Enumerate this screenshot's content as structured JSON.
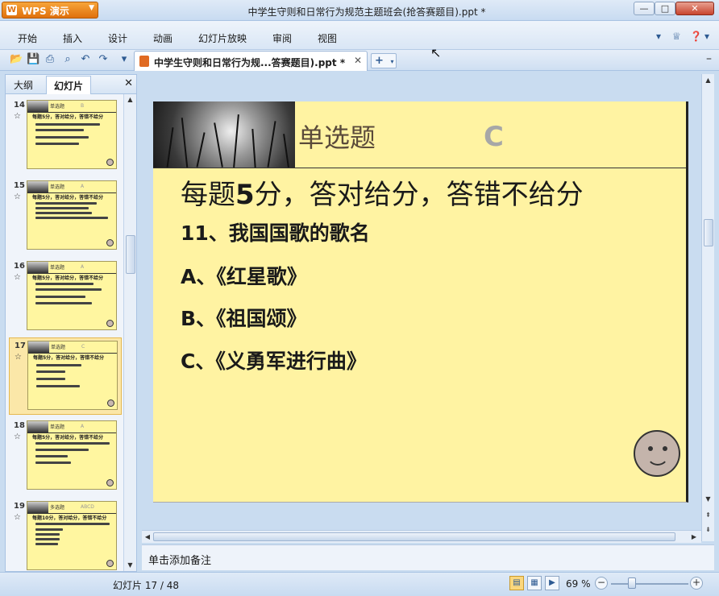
{
  "app": {
    "name": "WPS 演示",
    "window_title": "中学生守则和日常行为规范主题班会(抢答赛题目).ppt *"
  },
  "window_controls": {
    "minimize": "—",
    "maximize": "□",
    "close": "✕"
  },
  "menu": {
    "items": [
      "开始",
      "插入",
      "设计",
      "动画",
      "幻灯片放映",
      "审阅",
      "视图"
    ]
  },
  "document_tab": {
    "label": "中学生守则和日常行为规...答赛题目).ppt *",
    "close": "✕",
    "new_tab": "+"
  },
  "panel": {
    "tabs": [
      "大纲",
      "幻灯片"
    ],
    "active_tab": "幻灯片",
    "close": "✕",
    "thumbnails": [
      {
        "number": "14",
        "title": "单选题",
        "letter": "B",
        "heading": "每题5分，答对给分，答错不给分"
      },
      {
        "number": "15",
        "title": "单选题",
        "letter": "A",
        "heading": "每题5分，答对给分，答错不给分"
      },
      {
        "number": "16",
        "title": "单选题",
        "letter": "A",
        "heading": "每题5分，答对给分，答错不给分"
      },
      {
        "number": "17",
        "title": "单选题",
        "letter": "C",
        "heading": "每题5分，答对给分，答错不给分",
        "selected": true
      },
      {
        "number": "18",
        "title": "单选题",
        "letter": "A",
        "heading": "每题5分，答对给分，答错不给分"
      },
      {
        "number": "19",
        "title": "多选题",
        "letter": "ABCD",
        "heading": "每题10分，答对给分，答错不给分"
      }
    ]
  },
  "slide": {
    "title": "单选题",
    "answer": "C",
    "rule_prefix": "每题",
    "rule_points": "5",
    "rule_suffix": "分，答对给分，答错不给分",
    "question": "11、我国国歌的歌名",
    "options": [
      "A、《红星歌》",
      "B、《祖国颂》",
      "C、《义勇军进行曲》"
    ]
  },
  "notes": {
    "placeholder": "单击添加备注"
  },
  "status": {
    "slide_label": "幻灯片 17 / 48",
    "zoom": "69 %",
    "zoom_level": 0.27
  },
  "colors": {
    "slide_background": "#fff3a2",
    "answer_letter": "#a7a7a7",
    "selected_thumbnail": "#fbe7a8",
    "wps_button": "#e0700c"
  }
}
